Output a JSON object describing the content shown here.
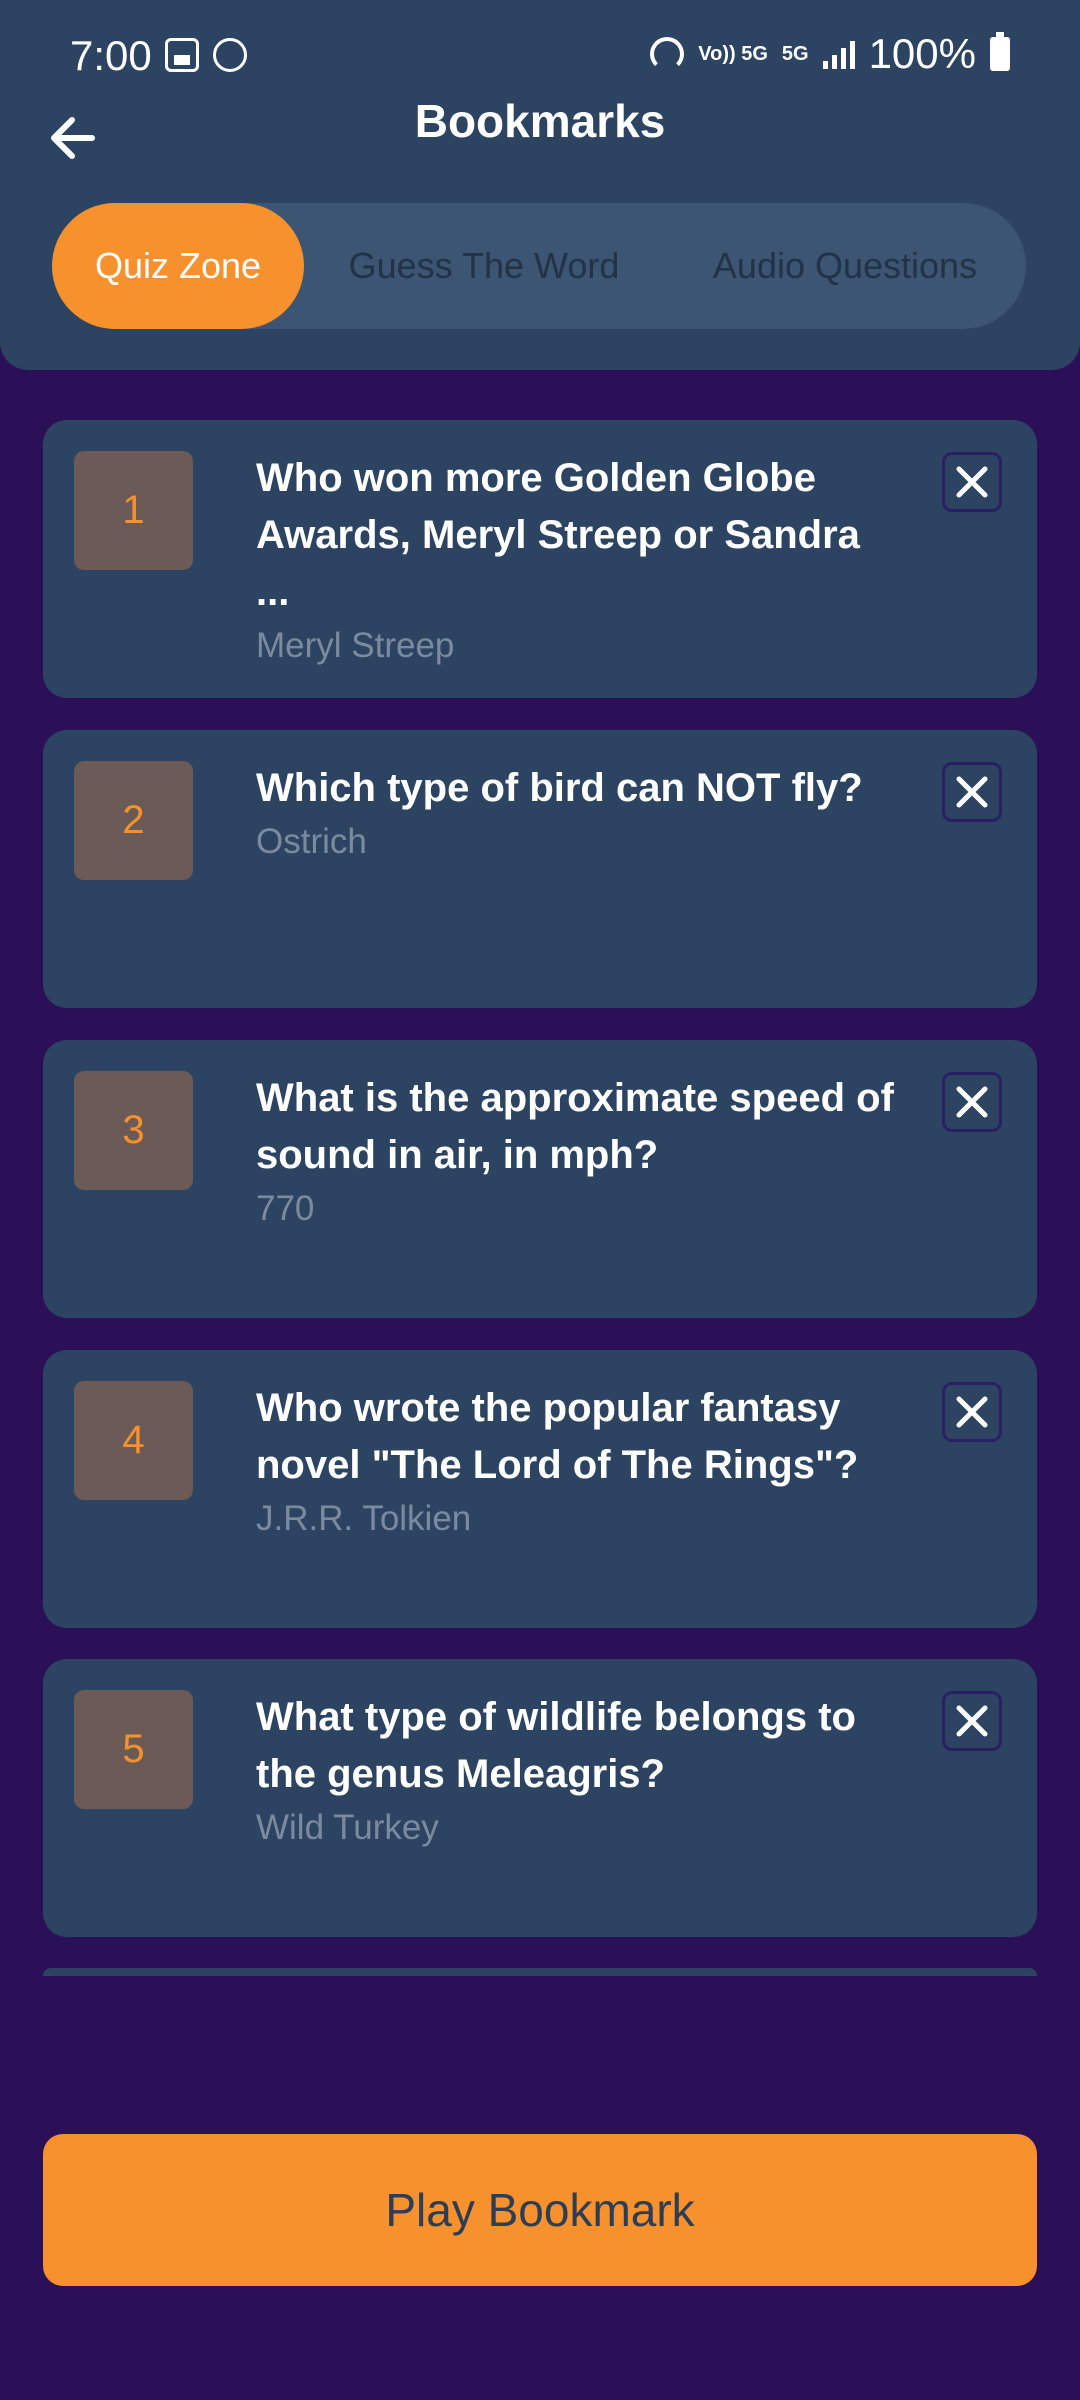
{
  "status_bar": {
    "time": "7:00",
    "network": "5G",
    "volte": "Vo)) 5G",
    "battery": "100%"
  },
  "header": {
    "title": "Bookmarks"
  },
  "tabs": [
    {
      "label": "Quiz Zone",
      "active": true
    },
    {
      "label": "Guess The Word",
      "active": false
    },
    {
      "label": "Audio Questions",
      "active": false
    }
  ],
  "bookmarks": [
    {
      "number": "1",
      "question": "Who won more Golden Globe Awards, Meryl Streep or Sandra ...",
      "answer": "Meryl Streep"
    },
    {
      "number": "2",
      "question": "Which type of bird can NOT fly?",
      "answer": "Ostrich"
    },
    {
      "number": "3",
      "question": "What is the approximate speed of sound in air, in mph?",
      "answer": "770"
    },
    {
      "number": "4",
      "question": "Who wrote the popular fantasy novel \"The Lord of The Rings\"?",
      "answer": "J.R.R. Tolkien"
    },
    {
      "number": "5",
      "question": "What type of wildlife belongs to the genus Meleagris?",
      "answer": "Wild Turkey"
    }
  ],
  "play_button": {
    "label": "Play Bookmark"
  },
  "colors": {
    "background": "#2b0f57",
    "card": "#2c4461",
    "accent": "#f7912d",
    "answer_text": "#7c8aa0"
  }
}
